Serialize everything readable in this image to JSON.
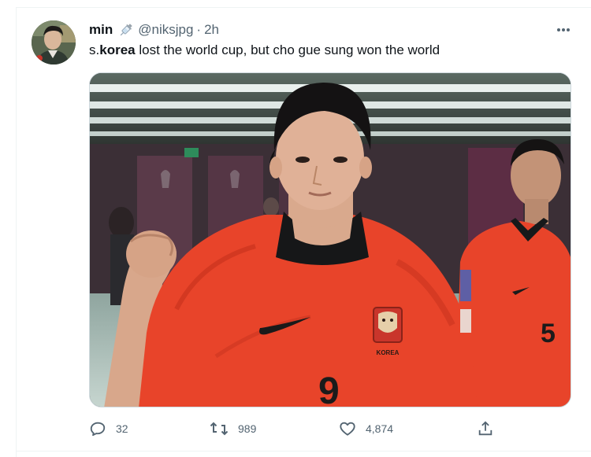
{
  "tweet": {
    "display_name": "min",
    "name_emoji": "syringe-emoji",
    "handle": "@niksjpg",
    "separator": "·",
    "time": "2h",
    "text_prefix": "s.",
    "text_bold": "korea",
    "text_suffix": " lost the world cup, but cho gue sung won the world",
    "media": {
      "description_icon": "photo",
      "jersey_number_center": "9",
      "jersey_number_right": "5",
      "crest_text": "KOREA"
    },
    "actions": {
      "reply_count": "32",
      "retweet_count": "989",
      "like_count": "4,874"
    }
  },
  "colors": {
    "text_primary": "#0f1419",
    "text_secondary": "#536471",
    "divider": "#eff3f4",
    "jersey_red": "#e8442a"
  }
}
